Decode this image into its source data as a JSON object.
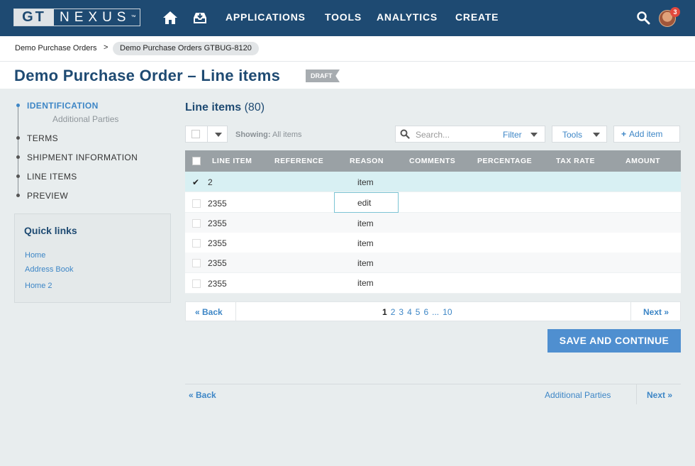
{
  "header": {
    "logo_left": "GT",
    "logo_right": "NEXUS",
    "logo_tm": "™",
    "nav": [
      "APPLICATIONS",
      "TOOLS",
      "ANALYTICS",
      "CREATE"
    ],
    "notification_count": "3"
  },
  "breadcrumb": {
    "parent": "Demo Purchase Orders",
    "separator": ">",
    "current": "Demo Purchase Orders GTBUG-8120"
  },
  "page": {
    "title": "Demo Purchase Order – Line items",
    "status": "DRAFT"
  },
  "steps": {
    "items": [
      "IDENTIFICATION",
      "TERMS",
      "SHIPMENT INFORMATION",
      "LINE ITEMS",
      "PREVIEW"
    ],
    "sub_item": "Additional Parties"
  },
  "quick_links": {
    "title": "Quick links",
    "links": [
      "Home",
      "Address Book",
      "Home 2"
    ]
  },
  "line_items": {
    "title": "Line items",
    "count": "(80)",
    "showing_label": "Showing:",
    "showing_value": "All items",
    "search_placeholder": "Search...",
    "filter_label": "Filter",
    "tools_label": "Tools",
    "add_label": "Add item",
    "columns": [
      "LINE ITEM",
      "REFERENCE",
      "REASON",
      "COMMENTS",
      "PERCENTAGE",
      "TAX RATE",
      "AMOUNT"
    ],
    "rows": [
      {
        "line_item": "2",
        "reason": "item",
        "checked": true
      },
      {
        "line_item": "2355",
        "reason": "edit",
        "editing": true
      },
      {
        "line_item": "2355",
        "reason": "item"
      },
      {
        "line_item": "2355",
        "reason": "item"
      },
      {
        "line_item": "2355",
        "reason": "item"
      },
      {
        "line_item": "2355",
        "reason": "item"
      }
    ]
  },
  "pagination": {
    "back": "« Back",
    "next": "Next »",
    "pages": [
      "1",
      "2",
      "3",
      "4",
      "5",
      "6",
      "...",
      "10"
    ],
    "current": "1"
  },
  "actions": {
    "save": "SAVE AND CONTINUE"
  },
  "footer": {
    "back": "« Back",
    "next_label": "Additional Parties",
    "next": "Next »"
  },
  "colors": {
    "brand": "#1e4a72",
    "accent": "#3d86c6",
    "primary_button": "#4f8fd0"
  }
}
